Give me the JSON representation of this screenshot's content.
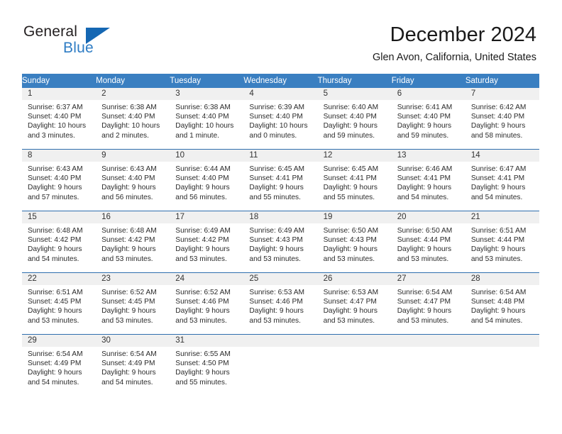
{
  "brand": {
    "name_part1": "General",
    "name_part2": "Blue",
    "accent_color": "#2e7cc4",
    "triangle_color": "#1567b3"
  },
  "header": {
    "title": "December 2024",
    "subtitle": "Glen Avon, California, United States"
  },
  "theme": {
    "header_bar_color": "#3a7fc1",
    "row_divider_color": "#2f6fae",
    "daynum_band_color": "#f0f0f0"
  },
  "weekday_headers": [
    "Sunday",
    "Monday",
    "Tuesday",
    "Wednesday",
    "Thursday",
    "Friday",
    "Saturday"
  ],
  "weeks": [
    [
      {
        "day": "1",
        "sunrise": "Sunrise: 6:37 AM",
        "sunset": "Sunset: 4:40 PM",
        "daylight_line1": "Daylight: 10 hours",
        "daylight_line2": "and 3 minutes."
      },
      {
        "day": "2",
        "sunrise": "Sunrise: 6:38 AM",
        "sunset": "Sunset: 4:40 PM",
        "daylight_line1": "Daylight: 10 hours",
        "daylight_line2": "and 2 minutes."
      },
      {
        "day": "3",
        "sunrise": "Sunrise: 6:38 AM",
        "sunset": "Sunset: 4:40 PM",
        "daylight_line1": "Daylight: 10 hours",
        "daylight_line2": "and 1 minute."
      },
      {
        "day": "4",
        "sunrise": "Sunrise: 6:39 AM",
        "sunset": "Sunset: 4:40 PM",
        "daylight_line1": "Daylight: 10 hours",
        "daylight_line2": "and 0 minutes."
      },
      {
        "day": "5",
        "sunrise": "Sunrise: 6:40 AM",
        "sunset": "Sunset: 4:40 PM",
        "daylight_line1": "Daylight: 9 hours",
        "daylight_line2": "and 59 minutes."
      },
      {
        "day": "6",
        "sunrise": "Sunrise: 6:41 AM",
        "sunset": "Sunset: 4:40 PM",
        "daylight_line1": "Daylight: 9 hours",
        "daylight_line2": "and 59 minutes."
      },
      {
        "day": "7",
        "sunrise": "Sunrise: 6:42 AM",
        "sunset": "Sunset: 4:40 PM",
        "daylight_line1": "Daylight: 9 hours",
        "daylight_line2": "and 58 minutes."
      }
    ],
    [
      {
        "day": "8",
        "sunrise": "Sunrise: 6:43 AM",
        "sunset": "Sunset: 4:40 PM",
        "daylight_line1": "Daylight: 9 hours",
        "daylight_line2": "and 57 minutes."
      },
      {
        "day": "9",
        "sunrise": "Sunrise: 6:43 AM",
        "sunset": "Sunset: 4:40 PM",
        "daylight_line1": "Daylight: 9 hours",
        "daylight_line2": "and 56 minutes."
      },
      {
        "day": "10",
        "sunrise": "Sunrise: 6:44 AM",
        "sunset": "Sunset: 4:40 PM",
        "daylight_line1": "Daylight: 9 hours",
        "daylight_line2": "and 56 minutes."
      },
      {
        "day": "11",
        "sunrise": "Sunrise: 6:45 AM",
        "sunset": "Sunset: 4:41 PM",
        "daylight_line1": "Daylight: 9 hours",
        "daylight_line2": "and 55 minutes."
      },
      {
        "day": "12",
        "sunrise": "Sunrise: 6:45 AM",
        "sunset": "Sunset: 4:41 PM",
        "daylight_line1": "Daylight: 9 hours",
        "daylight_line2": "and 55 minutes."
      },
      {
        "day": "13",
        "sunrise": "Sunrise: 6:46 AM",
        "sunset": "Sunset: 4:41 PM",
        "daylight_line1": "Daylight: 9 hours",
        "daylight_line2": "and 54 minutes."
      },
      {
        "day": "14",
        "sunrise": "Sunrise: 6:47 AM",
        "sunset": "Sunset: 4:41 PM",
        "daylight_line1": "Daylight: 9 hours",
        "daylight_line2": "and 54 minutes."
      }
    ],
    [
      {
        "day": "15",
        "sunrise": "Sunrise: 6:48 AM",
        "sunset": "Sunset: 4:42 PM",
        "daylight_line1": "Daylight: 9 hours",
        "daylight_line2": "and 54 minutes."
      },
      {
        "day": "16",
        "sunrise": "Sunrise: 6:48 AM",
        "sunset": "Sunset: 4:42 PM",
        "daylight_line1": "Daylight: 9 hours",
        "daylight_line2": "and 53 minutes."
      },
      {
        "day": "17",
        "sunrise": "Sunrise: 6:49 AM",
        "sunset": "Sunset: 4:42 PM",
        "daylight_line1": "Daylight: 9 hours",
        "daylight_line2": "and 53 minutes."
      },
      {
        "day": "18",
        "sunrise": "Sunrise: 6:49 AM",
        "sunset": "Sunset: 4:43 PM",
        "daylight_line1": "Daylight: 9 hours",
        "daylight_line2": "and 53 minutes."
      },
      {
        "day": "19",
        "sunrise": "Sunrise: 6:50 AM",
        "sunset": "Sunset: 4:43 PM",
        "daylight_line1": "Daylight: 9 hours",
        "daylight_line2": "and 53 minutes."
      },
      {
        "day": "20",
        "sunrise": "Sunrise: 6:50 AM",
        "sunset": "Sunset: 4:44 PM",
        "daylight_line1": "Daylight: 9 hours",
        "daylight_line2": "and 53 minutes."
      },
      {
        "day": "21",
        "sunrise": "Sunrise: 6:51 AM",
        "sunset": "Sunset: 4:44 PM",
        "daylight_line1": "Daylight: 9 hours",
        "daylight_line2": "and 53 minutes."
      }
    ],
    [
      {
        "day": "22",
        "sunrise": "Sunrise: 6:51 AM",
        "sunset": "Sunset: 4:45 PM",
        "daylight_line1": "Daylight: 9 hours",
        "daylight_line2": "and 53 minutes."
      },
      {
        "day": "23",
        "sunrise": "Sunrise: 6:52 AM",
        "sunset": "Sunset: 4:45 PM",
        "daylight_line1": "Daylight: 9 hours",
        "daylight_line2": "and 53 minutes."
      },
      {
        "day": "24",
        "sunrise": "Sunrise: 6:52 AM",
        "sunset": "Sunset: 4:46 PM",
        "daylight_line1": "Daylight: 9 hours",
        "daylight_line2": "and 53 minutes."
      },
      {
        "day": "25",
        "sunrise": "Sunrise: 6:53 AM",
        "sunset": "Sunset: 4:46 PM",
        "daylight_line1": "Daylight: 9 hours",
        "daylight_line2": "and 53 minutes."
      },
      {
        "day": "26",
        "sunrise": "Sunrise: 6:53 AM",
        "sunset": "Sunset: 4:47 PM",
        "daylight_line1": "Daylight: 9 hours",
        "daylight_line2": "and 53 minutes."
      },
      {
        "day": "27",
        "sunrise": "Sunrise: 6:54 AM",
        "sunset": "Sunset: 4:47 PM",
        "daylight_line1": "Daylight: 9 hours",
        "daylight_line2": "and 53 minutes."
      },
      {
        "day": "28",
        "sunrise": "Sunrise: 6:54 AM",
        "sunset": "Sunset: 4:48 PM",
        "daylight_line1": "Daylight: 9 hours",
        "daylight_line2": "and 54 minutes."
      }
    ],
    [
      {
        "day": "29",
        "sunrise": "Sunrise: 6:54 AM",
        "sunset": "Sunset: 4:49 PM",
        "daylight_line1": "Daylight: 9 hours",
        "daylight_line2": "and 54 minutes."
      },
      {
        "day": "30",
        "sunrise": "Sunrise: 6:54 AM",
        "sunset": "Sunset: 4:49 PM",
        "daylight_line1": "Daylight: 9 hours",
        "daylight_line2": "and 54 minutes."
      },
      {
        "day": "31",
        "sunrise": "Sunrise: 6:55 AM",
        "sunset": "Sunset: 4:50 PM",
        "daylight_line1": "Daylight: 9 hours",
        "daylight_line2": "and 55 minutes."
      },
      {
        "day": "",
        "sunrise": "",
        "sunset": "",
        "daylight_line1": "",
        "daylight_line2": ""
      },
      {
        "day": "",
        "sunrise": "",
        "sunset": "",
        "daylight_line1": "",
        "daylight_line2": ""
      },
      {
        "day": "",
        "sunrise": "",
        "sunset": "",
        "daylight_line1": "",
        "daylight_line2": ""
      },
      {
        "day": "",
        "sunrise": "",
        "sunset": "",
        "daylight_line1": "",
        "daylight_line2": ""
      }
    ]
  ]
}
